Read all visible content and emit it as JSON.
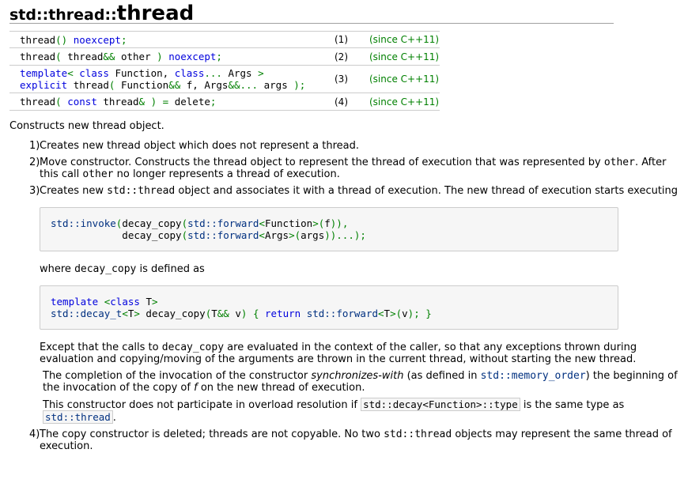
{
  "title": {
    "prefix": "std::thread::",
    "name": "thread"
  },
  "declarations": [
    {
      "num": "(1)",
      "since": "(since C++11)"
    },
    {
      "num": "(2)",
      "since": "(since C++11)"
    },
    {
      "num": "(3)",
      "since": "(since C++11)"
    },
    {
      "num": "(4)",
      "since": "(since C++11)"
    }
  ],
  "intro": "Constructs new thread object.",
  "items": {
    "m1": "1)",
    "t1": "Creates new thread object which does not represent a thread.",
    "m2": "2)",
    "t2a": "Move constructor. Constructs the thread object to represent the thread of execution that was represented by",
    "t2b": "other",
    "t2c": ". After this call",
    "t2d": "other",
    "t2e": "no longer represents a thread of execution.",
    "m3": "3)",
    "t3a": "Creates new",
    "t3b": "std::thread",
    "t3c": "object and associates it with a thread of execution. The new thread of execution starts executing",
    "where_a": "where",
    "where_b": "decay_copy",
    "where_c": "is defined as",
    "except_a": "Except that the calls to",
    "except_b": "decay_copy",
    "except_c": "are evaluated in the context of the caller, so that any exceptions thrown during evaluation and copying/moving of the arguments are thrown in the current thread, without starting the new thread.",
    "compl_a": "The completion of the invocation of the constructor",
    "compl_b": "synchronizes-with",
    "compl_c": "(as defined in",
    "compl_d": "std::memory_order",
    "compl_e": ") the beginning of the invocation of the copy of",
    "compl_f": "f",
    "compl_g": "on the new thread of execution.",
    "ovl_a": "This constructor does not participate in overload resolution if",
    "ovl_b": "std::decay<Function>::type",
    "ovl_c": "is the same type as",
    "ovl_d": "std::thread",
    "ovl_e": ".",
    "m4": "4)",
    "t4a": "The copy constructor is deleted; threads are not copyable. No two",
    "t4b": "std::thread",
    "t4c": "objects may represent the same thread of execution."
  }
}
